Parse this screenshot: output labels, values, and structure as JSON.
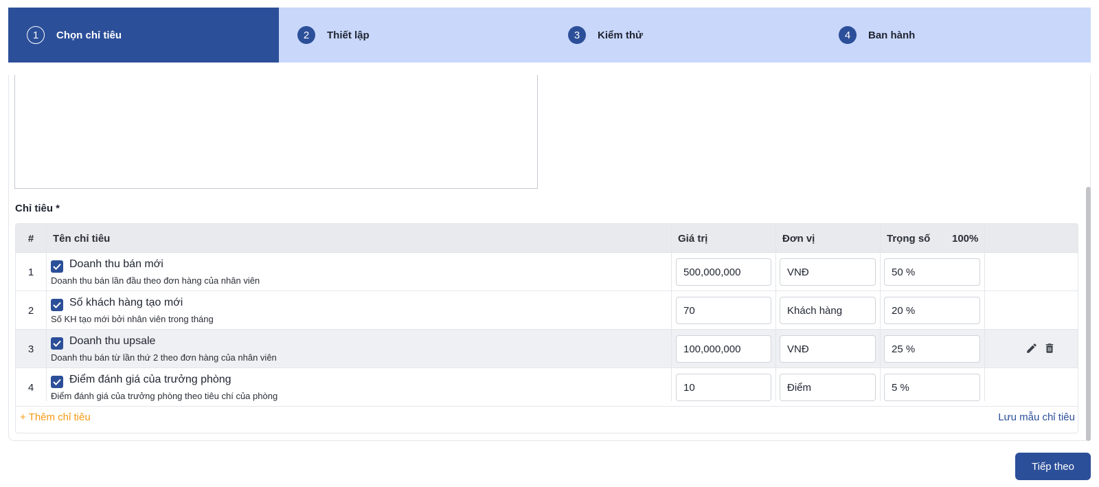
{
  "stepper": {
    "steps": [
      {
        "num": "1",
        "label": "Chọn chỉ tiêu"
      },
      {
        "num": "2",
        "label": "Thiết lập"
      },
      {
        "num": "3",
        "label": "Kiểm thử"
      },
      {
        "num": "4",
        "label": "Ban hành"
      }
    ],
    "active_index": 0
  },
  "section": {
    "title": "Chỉ tiêu *"
  },
  "table": {
    "headers": {
      "index": "#",
      "name": "Tên chỉ tiêu",
      "value": "Giá trị",
      "unit": "Đơn vị",
      "weight": "Trọng số",
      "weight_total": "100%"
    },
    "rows": [
      {
        "index": "1",
        "checked": true,
        "name": "Doanh thu bán mới",
        "desc": "Doanh thu bán lần đầu theo đơn hàng của nhân viên",
        "value": "500,000,000",
        "unit": "VNĐ",
        "weight": "50 %"
      },
      {
        "index": "2",
        "checked": true,
        "name": "Số khách hàng tạo mới",
        "desc": "Số KH tạo mới bởi nhân viên trong tháng",
        "value": "70",
        "unit": "Khách hàng",
        "weight": "20 %"
      },
      {
        "index": "3",
        "checked": true,
        "name": "Doanh thu upsale",
        "desc": "Doanh thu bán từ lần thứ 2 theo đơn hàng của nhân viên",
        "value": "100,000,000",
        "unit": "VNĐ",
        "weight": "25 %"
      },
      {
        "index": "4",
        "checked": true,
        "name": "Điểm đánh giá của trưởng phòng",
        "desc": "Điểm đánh giá của trưởng phòng theo tiêu chí của phòng",
        "value": "10",
        "unit": "Điểm",
        "weight": "5 %"
      }
    ],
    "add_label": "+ Thêm chỉ tiêu",
    "save_template_label": "Lưu mẫu chỉ tiêu"
  },
  "next_button": "Tiếp theo",
  "colors": {
    "primary": "#2c4f99",
    "stepper_bg": "#c9d7fb",
    "accent": "#f59a12"
  }
}
